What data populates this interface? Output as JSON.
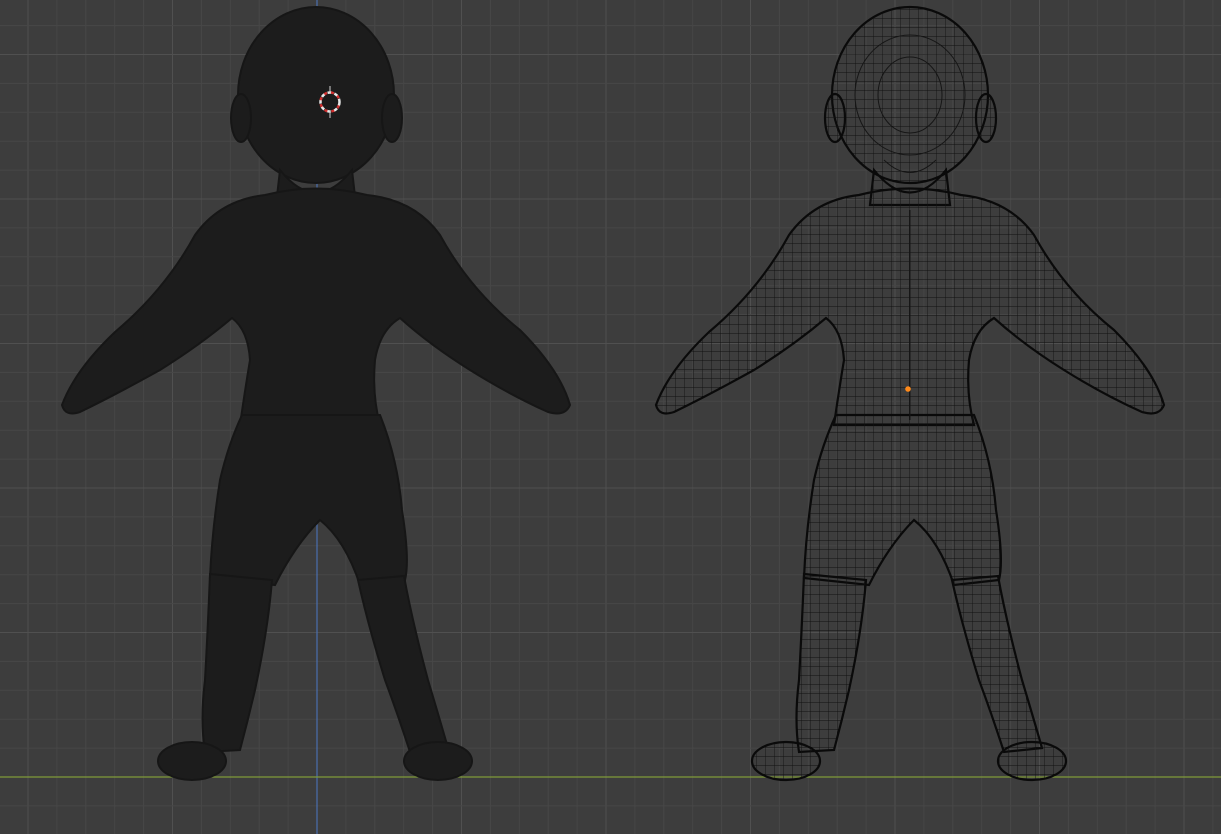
{
  "viewport": {
    "background": "#3d3d3d",
    "grid_minor_color": "#474747",
    "grid_major_color": "#505050",
    "x_axis_color": "#7f9a3a",
    "z_axis_color": "#4a6fae"
  },
  "objects": [
    {
      "name": "solid-figure",
      "shading": "solid",
      "fill": "#1c1c1c"
    },
    {
      "name": "wireframe-figure",
      "shading": "wireframe",
      "stroke": "#0c0c0c"
    }
  ],
  "cursor": {
    "icon": "3d-cursor-icon",
    "colors": [
      "#e8e8e8",
      "#d23030"
    ]
  },
  "origin_marker": {
    "icon": "object-origin-icon",
    "color": "#ff8a1a"
  }
}
